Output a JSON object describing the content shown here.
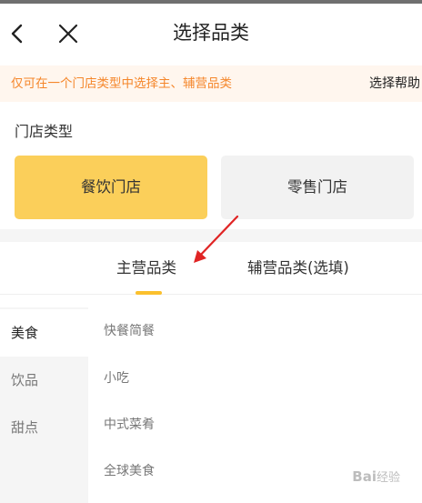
{
  "header": {
    "title": "选择品类"
  },
  "notice": {
    "text": "仅可在一个门店类型中选择主、辅营品类",
    "help_label": "选择帮助"
  },
  "store_type": {
    "label": "门店类型",
    "options": [
      {
        "label": "餐饮门店",
        "selected": true
      },
      {
        "label": "零售门店",
        "selected": false
      }
    ]
  },
  "tabs": [
    {
      "label": "主营品类",
      "active": true
    },
    {
      "label": "辅营品类(选填)",
      "active": false
    }
  ],
  "categories": [
    {
      "label": "美食",
      "active": true
    },
    {
      "label": "饮品",
      "active": false
    },
    {
      "label": "甜点",
      "active": false
    }
  ],
  "subcategories": [
    "快餐简餐",
    "小吃",
    "中式菜肴",
    "全球美食"
  ],
  "watermark": {
    "brand": "Bai",
    "suffix": "经验"
  },
  "colors": {
    "accent_yellow": "#fbcf5a",
    "tab_underline": "#fbc02d",
    "notice_text": "#f5862a",
    "notice_bg": "#fff6ee",
    "annotation_arrow": "#e02424"
  },
  "icons": {
    "back": "chevron-left-icon",
    "close": "close-icon"
  }
}
